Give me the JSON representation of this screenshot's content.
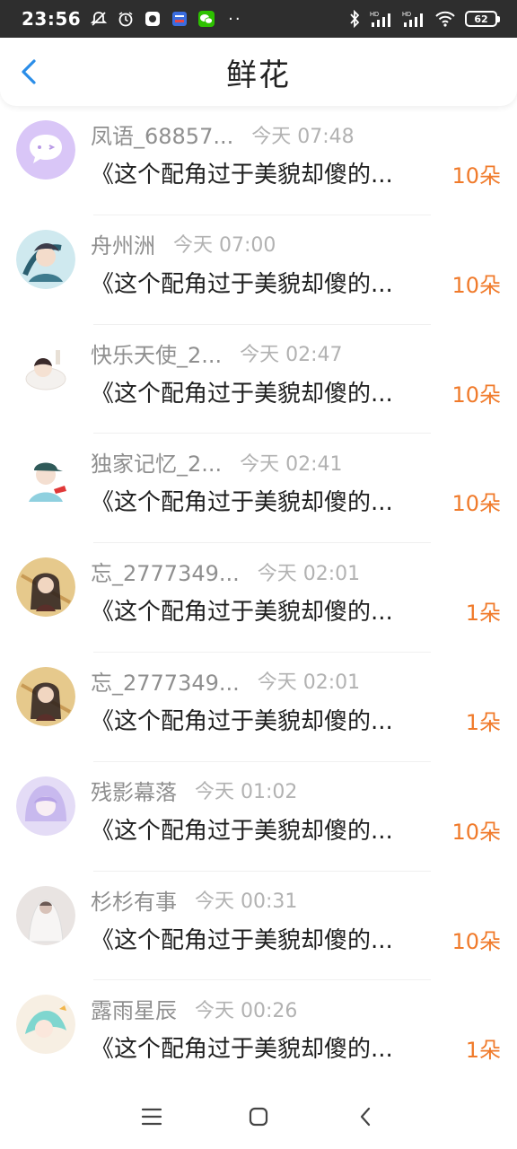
{
  "status_bar": {
    "time": "23:56",
    "battery": "62",
    "icons": [
      "mute-icon",
      "alarm-icon",
      "app-icon",
      "app2-icon",
      "wechat-icon",
      "bluetooth-icon",
      "signal-icon",
      "signal2-icon",
      "wifi-icon"
    ],
    "dots": "··"
  },
  "header": {
    "title": "鲜花",
    "back_icon": "chevron-left-icon",
    "accent": "#2a8de8"
  },
  "colors": {
    "flower_count": "#f07a2a",
    "name": "#8f8f8f",
    "time": "#b2b2b2"
  },
  "rows": [
    {
      "name": "凤语_68857...",
      "time": "今天 07:48",
      "message": "《这个配角过于美貌却傻的...",
      "count": "10朵",
      "avatar": "chat-bubble-avatar"
    },
    {
      "name": "舟州洲",
      "time": "今天 07:00",
      "message": "《这个配角过于美貌却傻的...",
      "count": "10朵",
      "avatar": "anime-avatar"
    },
    {
      "name": "快乐天使_2...",
      "time": "今天 02:47",
      "message": "《这个配角过于美貌却傻的...",
      "count": "10朵",
      "avatar": "chibi-avatar"
    },
    {
      "name": "独家记忆_2...",
      "time": "今天 02:41",
      "message": "《这个配角过于美貌却傻的...",
      "count": "10朵",
      "avatar": "cap-girl-avatar"
    },
    {
      "name": "忘_2777349...",
      "time": "今天 02:01",
      "message": "《这个配角过于美貌却傻的...",
      "count": "1朵",
      "avatar": "ancient-avatar"
    },
    {
      "name": "忘_2777349...",
      "time": "今天 02:01",
      "message": "《这个配角过于美貌却傻的...",
      "count": "1朵",
      "avatar": "ancient-avatar"
    },
    {
      "name": "残影幕落",
      "time": "今天 01:02",
      "message": "《这个配角过于美貌却傻的...",
      "count": "10朵",
      "avatar": "purple-hair-avatar"
    },
    {
      "name": "杉杉有事",
      "time": "今天 00:31",
      "message": "《这个配角过于美貌却傻的...",
      "count": "10朵",
      "avatar": "veil-avatar"
    },
    {
      "name": "露雨星辰",
      "time": "今天 00:26",
      "message": "《这个配角过于美貌却傻的...",
      "count": "1朵",
      "avatar": "cyan-avatar"
    }
  ],
  "nav": {
    "icons": [
      "menu-icon",
      "home-icon",
      "back-icon"
    ]
  }
}
